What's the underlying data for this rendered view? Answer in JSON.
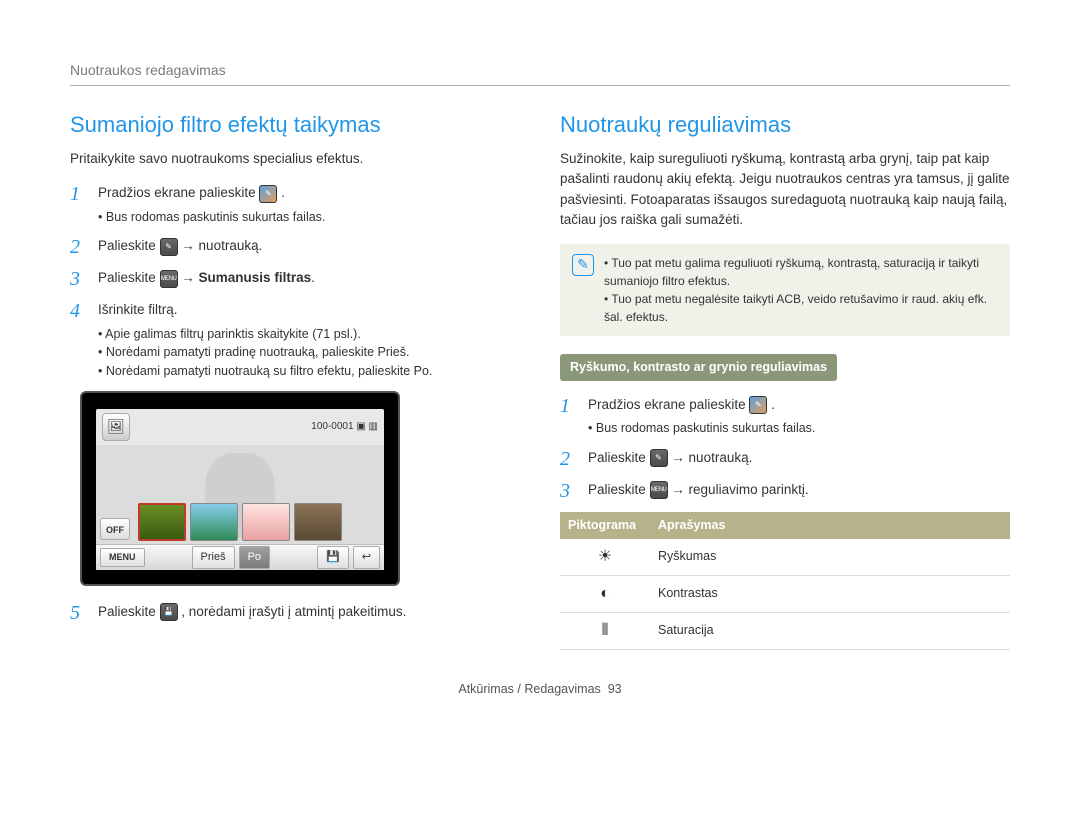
{
  "header": {
    "breadcrumb": "Nuotraukos redagavimas"
  },
  "left": {
    "title": "Sumaniojo filtro efektų taikymas",
    "intro": "Pritaikykite savo nuotraukoms specialius efektus.",
    "steps": [
      {
        "num": "1",
        "pre": "Pradžios ekrane palieskite ",
        "icon": "edit-photo-icon",
        "post": ".",
        "bullets": [
          "Bus rodomas paskutinis sukurtas failas."
        ]
      },
      {
        "num": "2",
        "pre": "Palieskite ",
        "icon": "edit-mode-icon",
        "post": " → nuotrauką."
      },
      {
        "num": "3",
        "pre": "Palieskite ",
        "icon": "MENU",
        "post_bold": " → Sumanusis filtras",
        "post": "."
      },
      {
        "num": "4",
        "pre": "Išrinkite filtrą.",
        "bullets": [
          "Apie galimas filtrų parinktis skaitykite (71 psl.).",
          "Norėdami pamatyti pradinę nuotrauką, palieskite Prieš.",
          "Norėdami pamatyti nuotrauką su filtro efektu, palieskite Po."
        ]
      },
      {
        "num": "5",
        "pre": "Palieskite ",
        "icon": "save-icon",
        "post": ", norėdami įrašyti į atmintį pakeitimus."
      }
    ],
    "screenshot": {
      "counter": "100-0001",
      "off_label": "OFF",
      "menu_label": "MENU",
      "before_label": "Prieš",
      "after_label": "Po"
    }
  },
  "right": {
    "title": "Nuotraukų reguliavimas",
    "intro": "Sužinokite, kaip sureguliuoti ryškumą, kontrastą arba grynį, taip pat kaip pašalinti raudonų akių efektą. Jeigu nuotraukos centras yra tamsus, jį galite pašviesinti. Fotoaparatas išsaugos suredaguotą nuotrauką kaip naują failą, tačiau jos raiška gali sumažėti.",
    "note": [
      "Tuo pat metu galima reguliuoti ryškumą, kontrastą, saturaciją ir taikyti sumaniojo filtro efektus.",
      "Tuo pat metu negalėsite taikyti ACB, veido retušavimo ir raud. akių efk. šal. efektus."
    ],
    "subheader": "Ryškumo, kontrasto ar grynio reguliavimas",
    "steps": [
      {
        "num": "1",
        "pre": "Pradžios ekrane palieskite ",
        "icon": "edit-photo-icon",
        "post": ".",
        "bullets": [
          "Bus rodomas paskutinis sukurtas failas."
        ]
      },
      {
        "num": "2",
        "pre": "Palieskite ",
        "icon": "edit-mode-icon",
        "post": " → nuotrauką."
      },
      {
        "num": "3",
        "pre": "Palieskite ",
        "icon": "MENU",
        "post": " → reguliavimo parinktį."
      }
    ],
    "table": {
      "headers": [
        "Piktograma",
        "Aprašymas"
      ],
      "rows": [
        {
          "icon": "☀",
          "desc": "Ryškumas"
        },
        {
          "icon": "◐",
          "desc": "Kontrastas"
        },
        {
          "icon": "⦀",
          "desc": "Saturacija"
        }
      ]
    }
  },
  "footer": {
    "section": "Atkūrimas / Redagavimas",
    "page": "93"
  }
}
